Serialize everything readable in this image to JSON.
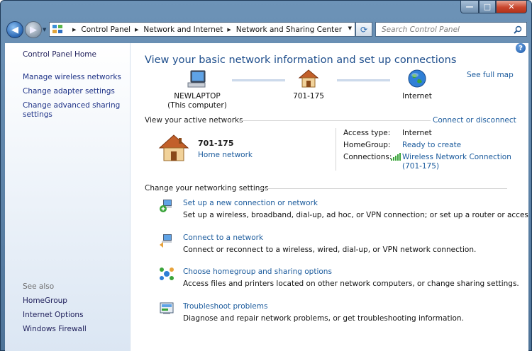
{
  "window": {
    "minimize_glyph": "—",
    "maximize_glyph": "□",
    "close_glyph": "✕"
  },
  "nav": {
    "back_glyph": "◀",
    "forward_glyph": "▶",
    "breadcrumbs": [
      "Control Panel",
      "Network and Internet",
      "Network and Sharing Center"
    ],
    "search_placeholder": "Search Control Panel",
    "refresh_glyph": "⟳"
  },
  "sidebar": {
    "home": "Control Panel Home",
    "links": [
      "Manage wireless networks",
      "Change adapter settings",
      "Change advanced sharing settings"
    ],
    "see_also_label": "See also",
    "see_also": [
      "HomeGroup",
      "Internet Options",
      "Windows Firewall"
    ]
  },
  "main": {
    "help_glyph": "?",
    "title": "View your basic network information and set up connections",
    "see_full_map": "See full map",
    "map": {
      "computer_name": "NEWLAPTOP",
      "computer_sub": "(This computer)",
      "network_name": "701-175",
      "internet": "Internet"
    },
    "active_networks": {
      "heading": "View your active networks",
      "connect_link": "Connect or disconnect",
      "network_name": "701-175",
      "network_type": "Home network",
      "access_type_label": "Access type:",
      "access_type_value": "Internet",
      "homegroup_label": "HomeGroup:",
      "homegroup_value": "Ready to create",
      "connections_label": "Connections:",
      "connection_value_line1": "Wireless Network Connection",
      "connection_value_line2": "(701-175)"
    },
    "settings": {
      "heading": "Change your networking settings",
      "tasks": [
        {
          "title": "Set up a new connection or network",
          "desc": "Set up a wireless, broadband, dial-up, ad hoc, or VPN connection; or set up a router or access point."
        },
        {
          "title": "Connect to a network",
          "desc": "Connect or reconnect to a wireless, wired, dial-up, or VPN network connection."
        },
        {
          "title": "Choose homegroup and sharing options",
          "desc": "Access files and printers located on other network computers, or change sharing settings."
        },
        {
          "title": "Troubleshoot problems",
          "desc": "Diagnose and repair network problems, or get troubleshooting information."
        }
      ]
    }
  },
  "colors": {
    "link": "#1a5a9c",
    "title": "#1e4e8c",
    "sidebar_link": "#1e3287"
  }
}
